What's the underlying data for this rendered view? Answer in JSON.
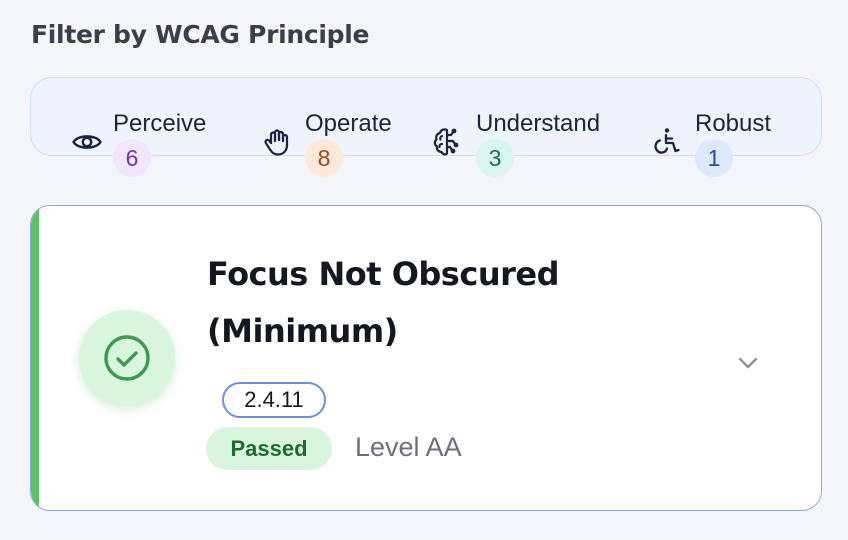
{
  "filter": {
    "heading": "Filter by WCAG Principle",
    "principles": [
      {
        "label": "Perceive",
        "count": "6",
        "icon": "eye-icon",
        "badge_bg": "#f1e6fb",
        "badge_color": "#6a3aa5"
      },
      {
        "label": "Operate",
        "count": "8",
        "icon": "hand-icon",
        "badge_bg": "#fde9d9",
        "badge_color": "#9a4a1b"
      },
      {
        "label": "Understand",
        "count": "3",
        "icon": "brain-icon",
        "badge_bg": "#d8f5ee",
        "badge_color": "#1d6b58"
      },
      {
        "label": "Robust",
        "count": "1",
        "icon": "accessibility-icon",
        "badge_bg": "#dde8fb",
        "badge_color": "#2a4f99"
      }
    ]
  },
  "criterion": {
    "title_line1": "Focus Not Obscured",
    "title_line2": "(Minimum)",
    "number": "2.4.11",
    "status": "Passed",
    "level": "Level AA",
    "status_icon": "check-circle-icon",
    "expand_icon": "chevron-down-icon",
    "accent_color": "#5cc168"
  }
}
